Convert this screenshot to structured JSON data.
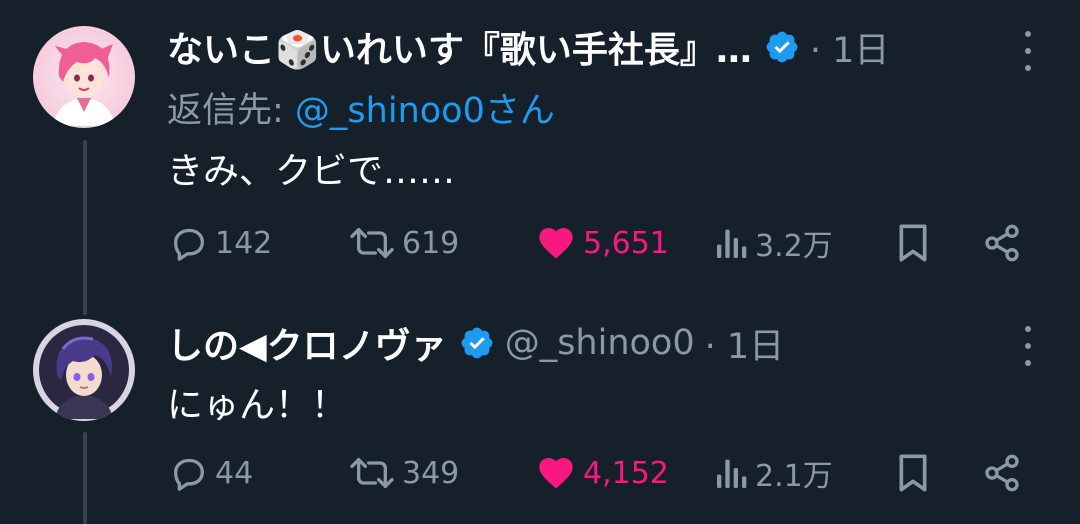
{
  "tweets": [
    {
      "display_name": "ないこ🎲いれいす『歌い手社長』…",
      "verified": true,
      "time": "· 1日",
      "reply_prefix": "返信先: ",
      "reply_handle": "@_shinoo0",
      "reply_suffix": "さん",
      "text": "きみ、クビで……",
      "replies": "142",
      "retweets": "619",
      "likes": "5,651",
      "views": "3.2万",
      "liked": true
    },
    {
      "display_name": "しの◀クロノヴァ",
      "verified": true,
      "handle": "@_shinoo0",
      "time": "· 1日",
      "text": "にゅん！！",
      "replies": "44",
      "retweets": "349",
      "likes": "4,152",
      "views": "2.1万",
      "liked": true
    }
  ],
  "colors": {
    "background": "#15202b",
    "muted": "#8b98a5",
    "accent": "#1d9bf0",
    "like": "#f91880",
    "thread_line": "#38444d"
  },
  "icons": [
    "verified-badge-icon",
    "more-icon",
    "reply-icon",
    "retweet-icon",
    "like-icon",
    "views-icon",
    "bookmark-icon",
    "share-icon"
  ]
}
